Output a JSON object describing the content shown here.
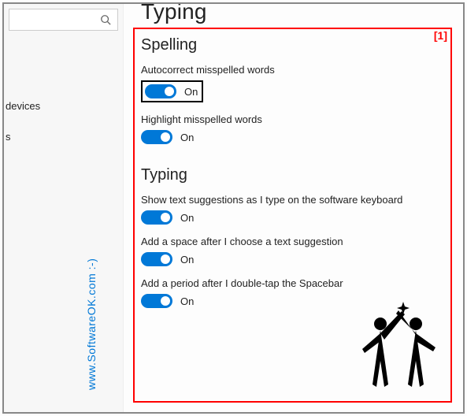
{
  "page_title": "Typing",
  "search": {
    "placeholder": ""
  },
  "sidebar": {
    "items": [
      {
        "label": " devices"
      },
      {
        "label": "s"
      },
      {
        "label": ""
      },
      {
        "label": ""
      }
    ]
  },
  "annotation": {
    "marker": "[1]"
  },
  "sections": [
    {
      "title": "Spelling",
      "settings": [
        {
          "label": "Autocorrect misspelled words",
          "state": "On",
          "boxed": true
        },
        {
          "label": "Highlight misspelled words",
          "state": "On",
          "boxed": false
        }
      ]
    },
    {
      "title": "Typing",
      "settings": [
        {
          "label": "Show text suggestions as I type on the software keyboard",
          "state": "On",
          "boxed": false
        },
        {
          "label": "Add a space after I choose a text suggestion",
          "state": "On",
          "boxed": false
        },
        {
          "label": "Add a period after I double-tap the Spacebar",
          "state": "On",
          "boxed": false
        }
      ]
    }
  ],
  "watermark": "www.SoftwareOK.com :-)"
}
